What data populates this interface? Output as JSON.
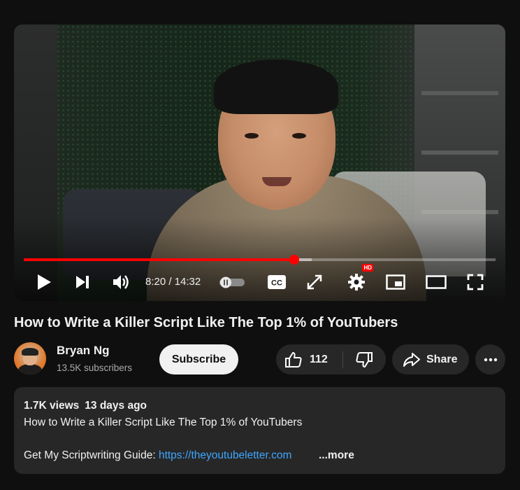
{
  "player": {
    "current_time": "8:20",
    "duration": "14:32",
    "time_label": "8:20 / 14:32",
    "progress_played_fraction": 0.574,
    "progress_buffered_fraction": 0.61,
    "hd_badge": "HD",
    "accent_color": "#ff0000"
  },
  "video": {
    "title": "How to Write a Killer Script Like The Top 1% of YouTubers"
  },
  "channel": {
    "name": "Bryan Ng",
    "subscribers": "13.5K subscribers",
    "subscribe_label": "Subscribe"
  },
  "actions": {
    "like_count": "112",
    "share_label": "Share"
  },
  "description": {
    "views": "1.7K views",
    "date": "13 days ago",
    "line1": "How to Write a Killer Script Like The Top 1% of YouTubers",
    "line2_prefix": "Get My Scriptwriting Guide: ",
    "link": "https://theyoutubeletter.com",
    "more_label": "...more"
  },
  "icons": {
    "play": "play-icon",
    "next": "next-icon",
    "volume": "volume-icon",
    "autoplay": "autoplay-toggle-icon",
    "captions": "captions-icon",
    "resize": "expand-arrows-icon",
    "settings": "gear-icon",
    "miniplayer": "miniplayer-icon",
    "theater": "theater-mode-icon",
    "fullscreen": "fullscreen-icon",
    "like": "thumbs-up-icon",
    "dislike": "thumbs-down-icon",
    "share": "share-arrow-icon",
    "more": "more-dots-icon"
  },
  "colors": {
    "background": "#0f0f0f",
    "surface": "#272727",
    "link": "#3ea6ff",
    "secondary_text": "#aaaaaa"
  }
}
